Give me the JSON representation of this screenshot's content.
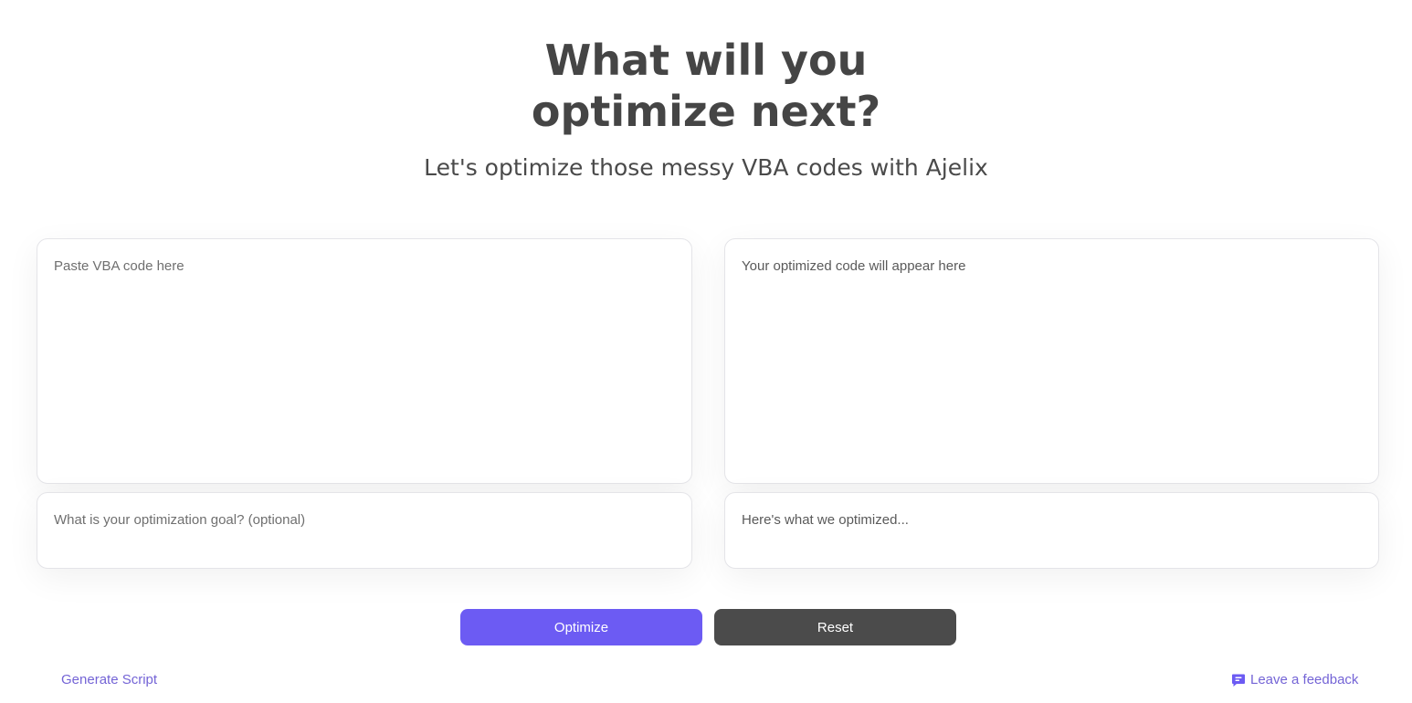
{
  "hero": {
    "title_line1": "What will you",
    "title_line2": "optimize next?",
    "subtitle": "Let's optimize those messy VBA codes with Ajelix"
  },
  "input": {
    "code_placeholder": "Paste VBA code here",
    "goal_placeholder": "What is your optimization goal? (optional)"
  },
  "output": {
    "code_placeholder": "Your optimized code will appear here",
    "notes_placeholder": "Here's what we optimized..."
  },
  "actions": {
    "optimize_label": "Optimize",
    "reset_label": "Reset"
  },
  "footer": {
    "generate_label": "Generate Script",
    "feedback_label": "Leave a feedback",
    "feedback_icon": "chat-bubble-icon"
  },
  "colors": {
    "primary": "#6c5bf3",
    "secondary_button": "#4b4b4b",
    "link": "#7464d6",
    "heading": "#454545"
  }
}
